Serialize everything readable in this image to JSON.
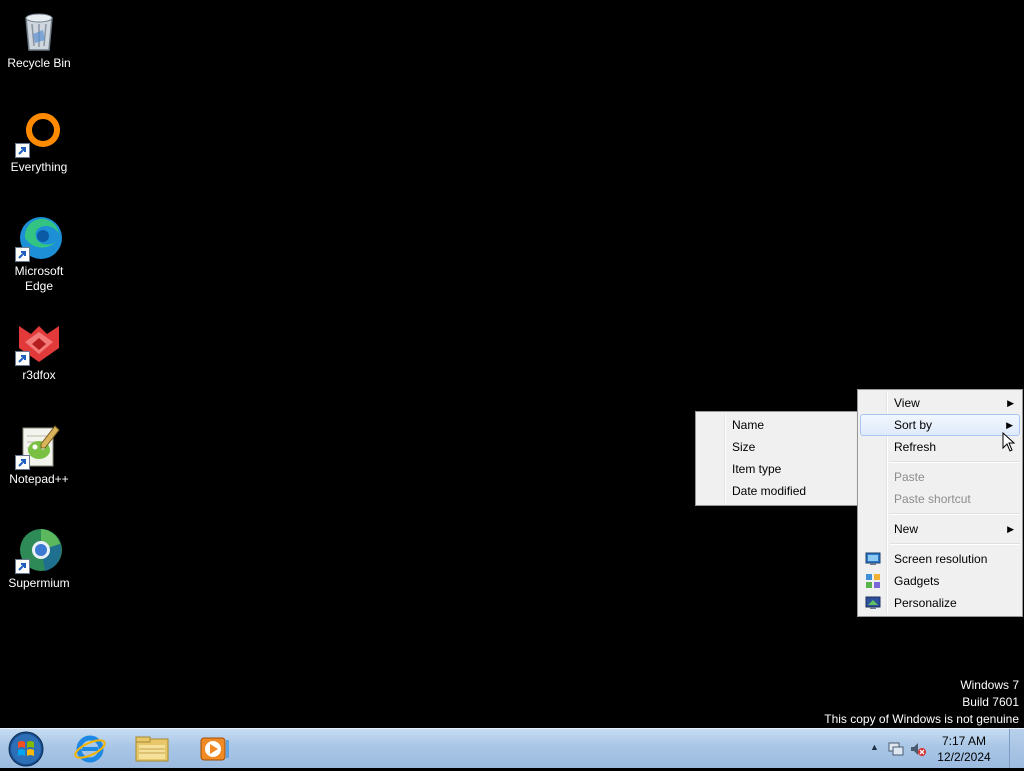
{
  "desktop": {
    "icons": [
      {
        "label": "Recycle Bin",
        "icon": "recycle-bin-icon"
      },
      {
        "label": "Everything",
        "icon": "everything-icon"
      },
      {
        "label": "Microsoft Edge",
        "icon": "edge-icon"
      },
      {
        "label": "r3dfox",
        "icon": "r3dfox-icon"
      },
      {
        "label": "Notepad++",
        "icon": "notepadpp-icon"
      },
      {
        "label": "Supermium",
        "icon": "supermium-icon"
      }
    ]
  },
  "context_menu": {
    "items": [
      {
        "label": "View",
        "has_submenu": true
      },
      {
        "label": "Sort by",
        "has_submenu": true,
        "highlighted": true
      },
      {
        "label": "Refresh"
      },
      {
        "label": "Paste",
        "disabled": true
      },
      {
        "label": "Paste shortcut",
        "disabled": true
      },
      {
        "label": "New",
        "has_submenu": true
      },
      {
        "label": "Screen resolution",
        "icon": "screen-resolution-icon"
      },
      {
        "label": "Gadgets",
        "icon": "gadgets-icon"
      },
      {
        "label": "Personalize",
        "icon": "personalize-icon"
      }
    ]
  },
  "sort_submenu": {
    "items": [
      {
        "label": "Name"
      },
      {
        "label": "Size"
      },
      {
        "label": "Item type"
      },
      {
        "label": "Date modified"
      }
    ]
  },
  "watermark": {
    "line1": "Windows 7",
    "line2": "Build 7601",
    "line3": "This copy of Windows is not genuine"
  },
  "taskbar": {
    "pinned": [
      "internet-explorer-icon",
      "file-explorer-icon",
      "media-player-icon"
    ],
    "clock": {
      "time": "7:17 AM",
      "date": "12/2/2024"
    }
  },
  "colors": {
    "desktop_bg": "#000000",
    "taskbar_top": "#c6dcf1",
    "menu_bg": "#f0f0f0",
    "menu_highlight_border": "#a8c6ee"
  }
}
